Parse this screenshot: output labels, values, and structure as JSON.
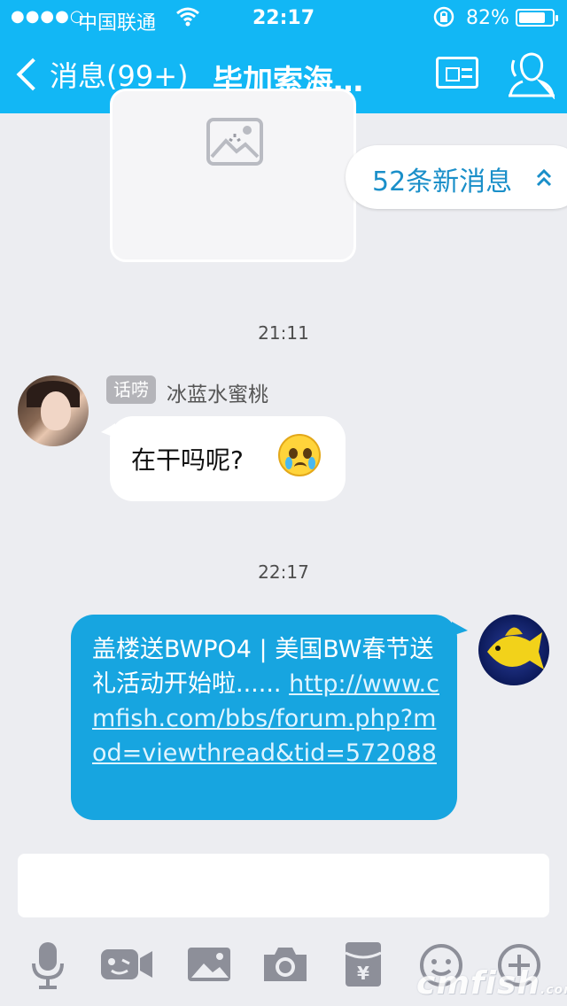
{
  "status": {
    "signal": "●●●●○",
    "carrier": "中国联通",
    "time": "22:17",
    "battery": "82%",
    "battery_level": 0.82
  },
  "nav": {
    "back_label": "消息(99+)",
    "title": "毕加索海…"
  },
  "new_messages": {
    "label": "52条新消息"
  },
  "chat": {
    "timestamp_1": "21:11",
    "incoming": {
      "tag": "话唠",
      "sender": "冰蓝水蜜桃",
      "text": "在干吗呢?"
    },
    "timestamp_2": "22:17",
    "outgoing": {
      "text": "盖楼送BWPO4 | 美国BW春节送礼活动开始啦...... ",
      "link": "http://www.cmfish.com/bbs/forum.php?mod=viewthread&tid=572088"
    }
  },
  "composer": {
    "value": ""
  },
  "watermark": {
    "text": "cmfish",
    "suffix": ".com"
  },
  "icons": [
    "microphone-icon",
    "video-call-icon",
    "image-icon",
    "camera-icon",
    "red-packet-icon",
    "emoji-icon",
    "plus-icon",
    "profile-icon",
    "contact-card-icon",
    "wifi-icon",
    "rotation-lock-icon",
    "double-chevron-up-icon",
    "image-placeholder-icon"
  ],
  "colors": {
    "header": "#12b7f5",
    "background": "#ecedf1",
    "outgoing_bubble": "#17a5e0",
    "toolbar_icon": "#8d8f99"
  }
}
